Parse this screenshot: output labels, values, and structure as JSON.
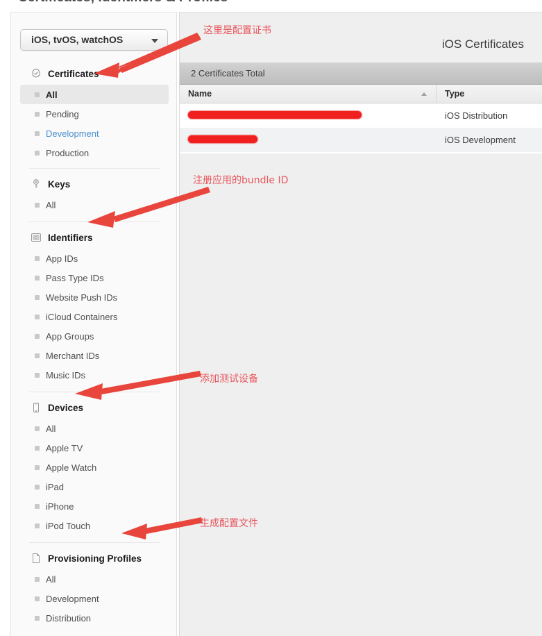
{
  "page": {
    "title": "Certificates, Identifiers & Profiles"
  },
  "sidebar": {
    "platform_select": {
      "value": "iOS, tvOS, watchOS",
      "caret_icon": "chevron-down-icon"
    },
    "groups": [
      {
        "key": "certificates",
        "label": "Certificates",
        "icon": "certificate-seal-icon",
        "items": [
          {
            "label": "All",
            "state": "selected"
          },
          {
            "label": "Pending",
            "state": "normal"
          },
          {
            "label": "Development",
            "state": "link"
          },
          {
            "label": "Production",
            "state": "normal"
          }
        ]
      },
      {
        "key": "keys",
        "label": "Keys",
        "icon": "key-icon",
        "items": [
          {
            "label": "All",
            "state": "normal"
          }
        ]
      },
      {
        "key": "identifiers",
        "label": "Identifiers",
        "icon": "id-badge-icon",
        "items": [
          {
            "label": "App IDs",
            "state": "normal"
          },
          {
            "label": "Pass Type IDs",
            "state": "normal"
          },
          {
            "label": "Website Push IDs",
            "state": "normal"
          },
          {
            "label": "iCloud Containers",
            "state": "normal"
          },
          {
            "label": "App Groups",
            "state": "normal"
          },
          {
            "label": "Merchant IDs",
            "state": "normal"
          },
          {
            "label": "Music IDs",
            "state": "normal"
          }
        ]
      },
      {
        "key": "devices",
        "label": "Devices",
        "icon": "device-phone-icon",
        "items": [
          {
            "label": "All",
            "state": "normal"
          },
          {
            "label": "Apple TV",
            "state": "normal"
          },
          {
            "label": "Apple Watch",
            "state": "normal"
          },
          {
            "label": "iPad",
            "state": "normal"
          },
          {
            "label": "iPhone",
            "state": "normal"
          },
          {
            "label": "iPod Touch",
            "state": "normal"
          }
        ]
      },
      {
        "key": "provisioning-profiles",
        "label": "Provisioning Profiles",
        "icon": "document-page-icon",
        "items": [
          {
            "label": "All",
            "state": "normal"
          },
          {
            "label": "Development",
            "state": "normal"
          },
          {
            "label": "Distribution",
            "state": "normal"
          }
        ]
      }
    ]
  },
  "main": {
    "title": "iOS Certificates",
    "count_label": "2 Certificates Total",
    "table": {
      "columns": [
        {
          "key": "name",
          "label": "Name",
          "sorted": "asc",
          "sort_icon": "sort-ascending-icon"
        },
        {
          "key": "type",
          "label": "Type",
          "sorted": "none"
        }
      ],
      "rows": [
        {
          "name": "",
          "name_redacted": true,
          "type": "iOS Distribution"
        },
        {
          "name": "",
          "name_redacted": true,
          "type": "iOS Development"
        }
      ]
    }
  },
  "annotations": {
    "color": "#e8565c",
    "notes": [
      {
        "id": "note-certificates",
        "text": "这里是配置证书"
      },
      {
        "id": "note-identifiers",
        "text": "注册应用的bundle ID"
      },
      {
        "id": "note-devices",
        "text": "添加测试设备"
      },
      {
        "id": "note-profiles",
        "text": "生成配置文件"
      }
    ]
  }
}
